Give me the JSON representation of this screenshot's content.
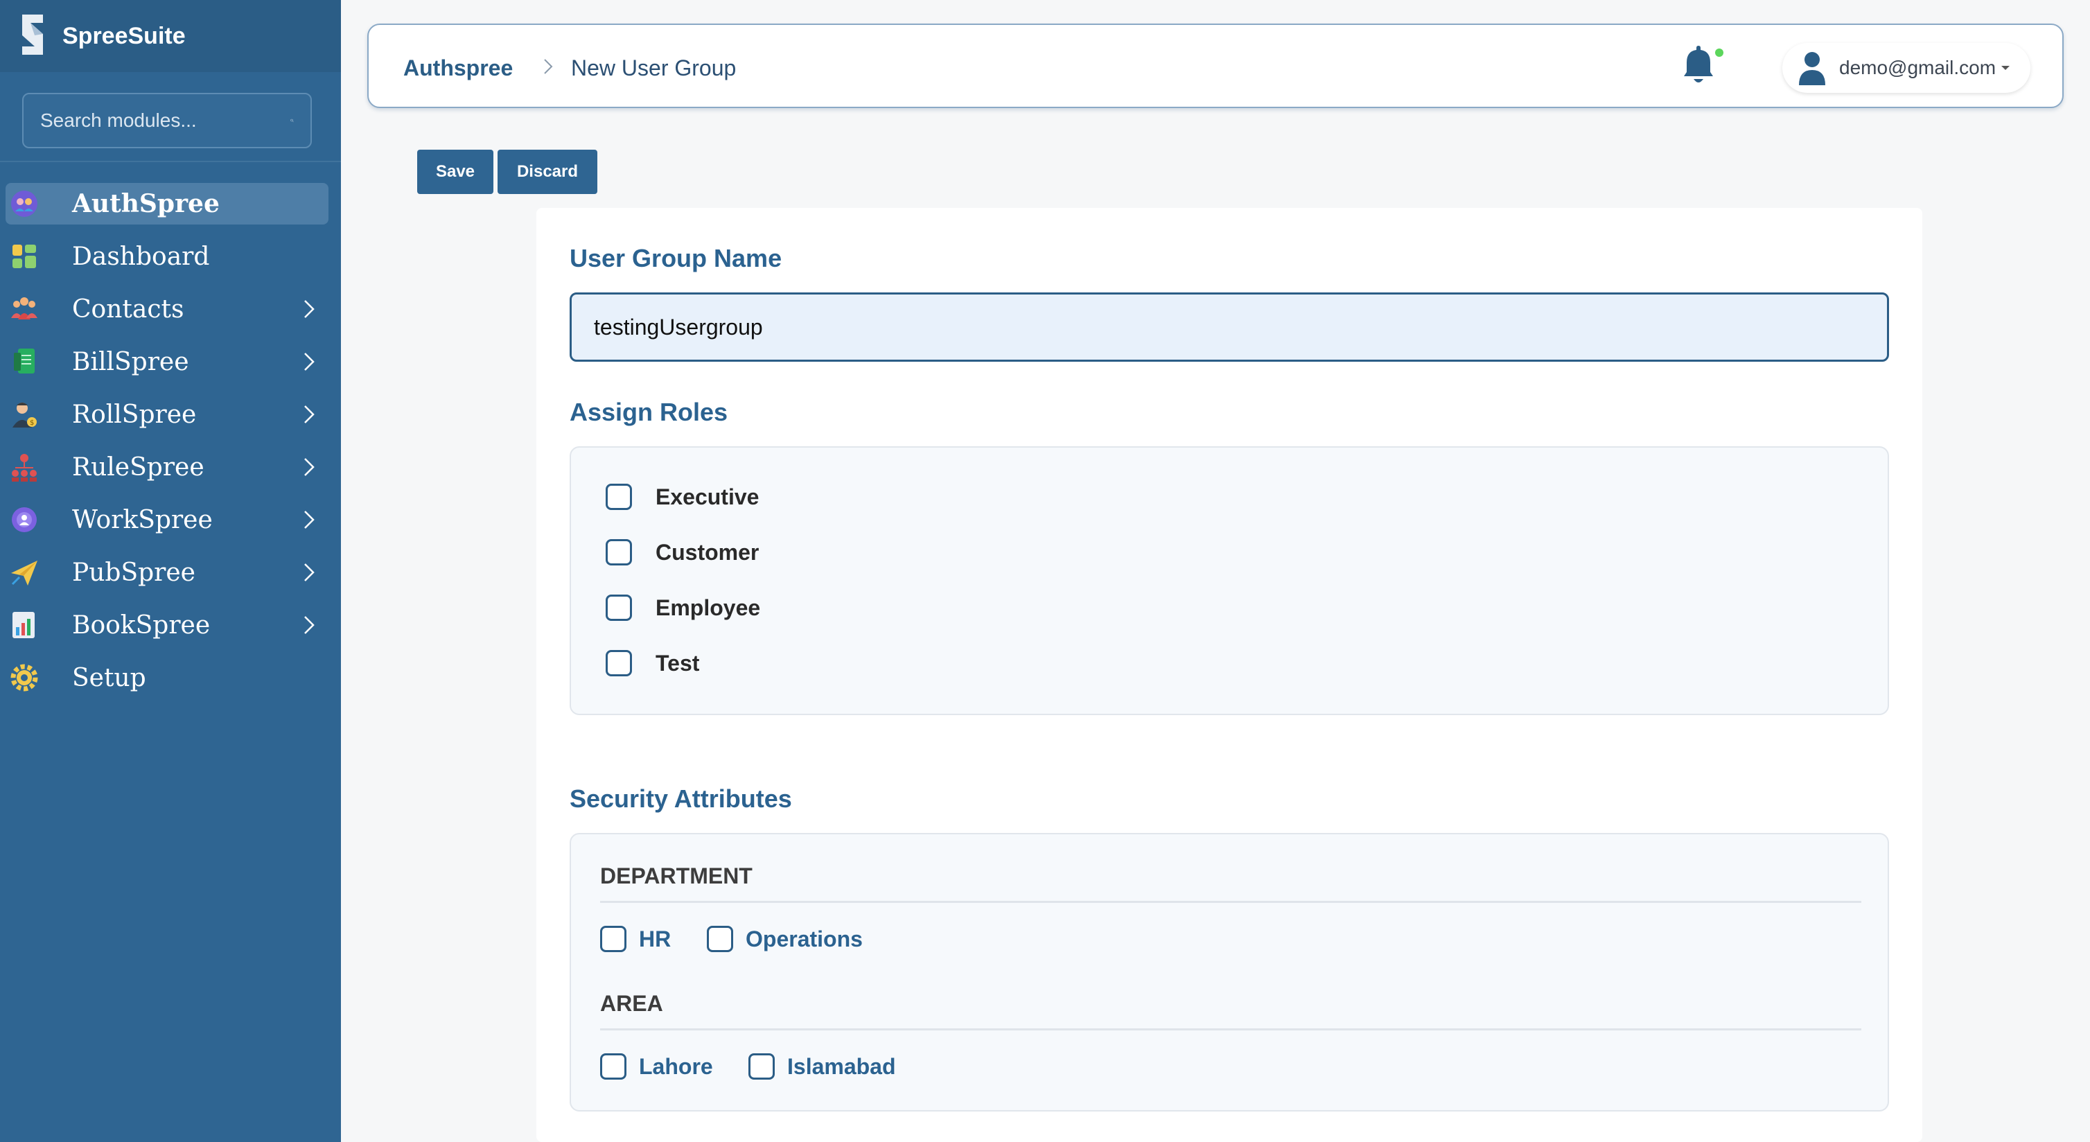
{
  "brand": {
    "name": "SpreeSuite"
  },
  "search": {
    "placeholder": "Search modules..."
  },
  "sidebar": {
    "items": [
      {
        "label": "AuthSpree",
        "icon": "shield-people-icon",
        "active": true,
        "has_children": false
      },
      {
        "label": "Dashboard",
        "icon": "dashboard-grid-icon",
        "active": false,
        "has_children": false
      },
      {
        "label": "Contacts",
        "icon": "contacts-group-icon",
        "active": false,
        "has_children": true
      },
      {
        "label": "BillSpree",
        "icon": "bill-document-icon",
        "active": false,
        "has_children": true
      },
      {
        "label": "RollSpree",
        "icon": "payroll-person-icon",
        "active": false,
        "has_children": true
      },
      {
        "label": "RuleSpree",
        "icon": "hierarchy-icon",
        "active": false,
        "has_children": true
      },
      {
        "label": "WorkSpree",
        "icon": "team-gear-icon",
        "active": false,
        "has_children": true
      },
      {
        "label": "PubSpree",
        "icon": "paper-plane-icon",
        "active": false,
        "has_children": true
      },
      {
        "label": "BookSpree",
        "icon": "ledger-chart-icon",
        "active": false,
        "has_children": true
      },
      {
        "label": "Setup",
        "icon": "gear-icon",
        "active": false,
        "has_children": false
      }
    ]
  },
  "header": {
    "breadcrumb_root": "Authspree",
    "breadcrumb_current": "New User Group",
    "notification_dot_color": "#5cd65c",
    "user_email": "demo@gmail.com"
  },
  "toolbar": {
    "save_label": "Save",
    "discard_label": "Discard"
  },
  "form": {
    "group_name_label": "User Group Name",
    "group_name_value": "testingUsergroup",
    "roles_label": "Assign Roles",
    "roles": [
      {
        "label": "Executive",
        "checked": false
      },
      {
        "label": "Customer",
        "checked": false
      },
      {
        "label": "Employee",
        "checked": false
      },
      {
        "label": "Test",
        "checked": false
      }
    ],
    "security_label": "Security Attributes",
    "attributes": [
      {
        "name": "DEPARTMENT",
        "options": [
          {
            "label": "HR",
            "checked": false
          },
          {
            "label": "Operations",
            "checked": false
          }
        ]
      },
      {
        "name": "AREA",
        "options": [
          {
            "label": "Lahore",
            "checked": false
          },
          {
            "label": "Islamabad",
            "checked": false
          }
        ]
      }
    ]
  },
  "colors": {
    "sidebar": "#2f6592",
    "accent": "#2b5d86",
    "active_nav": "#4e7ea7"
  }
}
